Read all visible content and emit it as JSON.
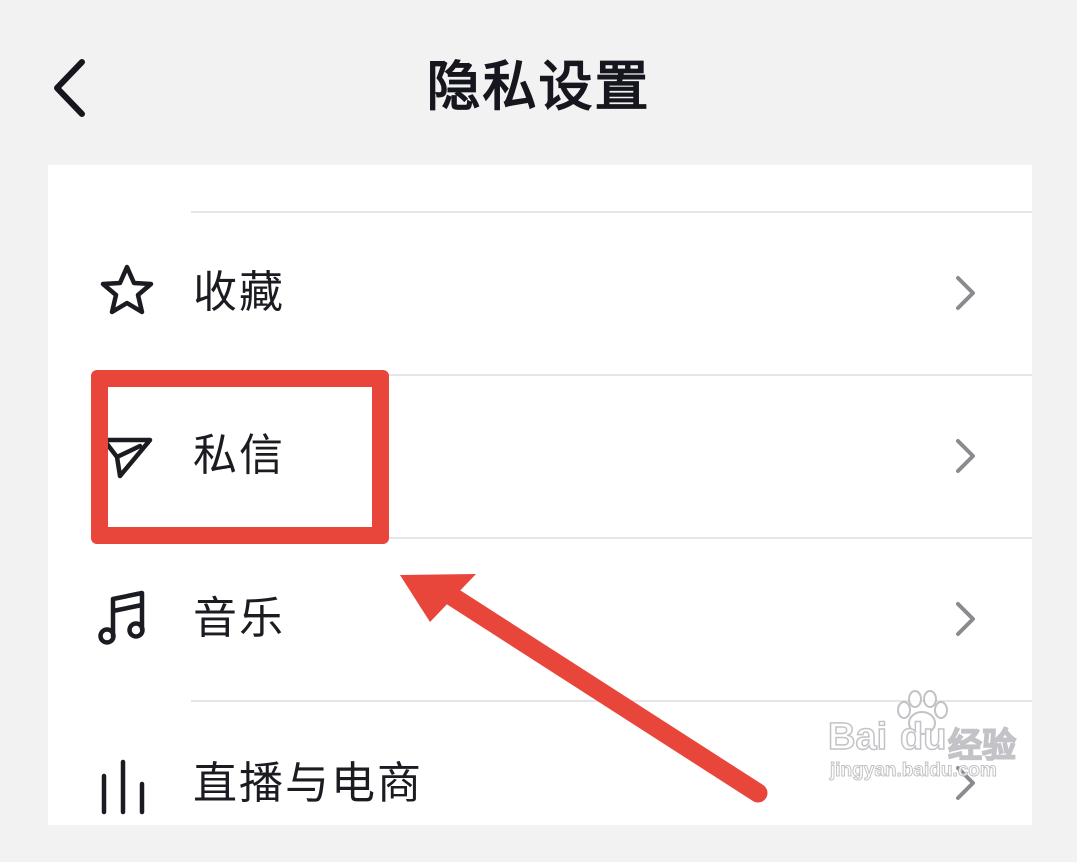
{
  "header": {
    "title": "隐私设置",
    "back_icon": "chevron-left-icon"
  },
  "rows": [
    {
      "label": "收藏",
      "icon": "star-icon"
    },
    {
      "label": "私信",
      "icon": "send-icon"
    },
    {
      "label": "音乐",
      "icon": "music-note-icon"
    },
    {
      "label": "直播与电商",
      "icon": "bars-icon"
    }
  ],
  "annotation": {
    "color": "#e8463b"
  },
  "watermark": {
    "brand": "Bai",
    "brand_end": "du",
    "brand_cn": "经验",
    "url": "jingyan.baidu.com"
  }
}
